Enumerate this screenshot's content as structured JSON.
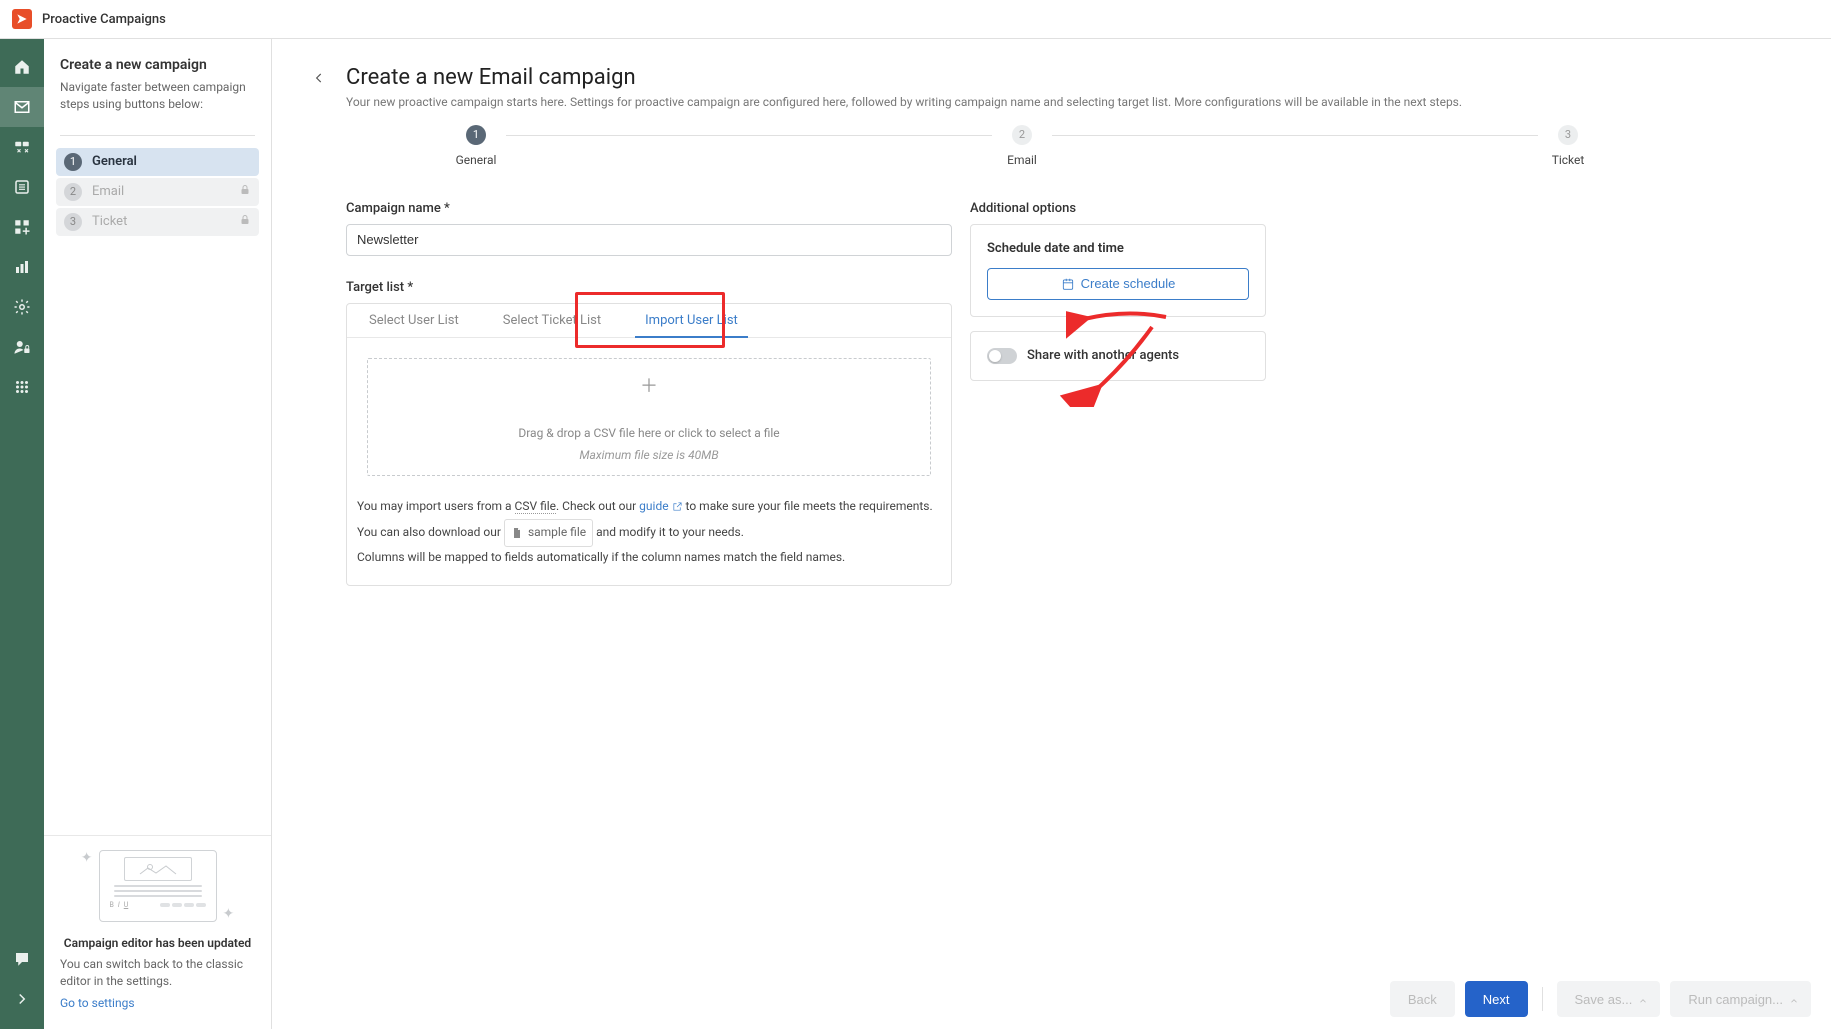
{
  "header": {
    "app_title": "Proactive Campaigns"
  },
  "sidebar": {
    "title": "Create a new campaign",
    "subtitle": "Navigate faster between campaign steps using buttons below:",
    "steps": [
      {
        "num": "1",
        "label": "General"
      },
      {
        "num": "2",
        "label": "Email"
      },
      {
        "num": "3",
        "label": "Ticket"
      }
    ],
    "updated_title": "Campaign editor has been updated",
    "updated_text": "You can switch back to the classic editor in the settings.",
    "updated_link": "Go to settings"
  },
  "page": {
    "title": "Create a new Email campaign",
    "subtitle": "Your new proactive campaign starts here. Settings for proactive campaign are configured here, followed by writing campaign name and selecting target list. More configurations will be available in the next steps."
  },
  "stepper": {
    "items": [
      {
        "num": "1",
        "label": "General"
      },
      {
        "num": "2",
        "label": "Email"
      },
      {
        "num": "3",
        "label": "Ticket"
      }
    ]
  },
  "form": {
    "campaign_name_label": "Campaign name *",
    "campaign_name_value": "Newsletter",
    "target_list_label": "Target list *",
    "tabs": {
      "select_user": "Select User List",
      "select_ticket": "Select Ticket List",
      "import_user": "Import User List"
    },
    "dropzone": {
      "text": "Drag & drop a CSV file here or click to select a file",
      "hint": "Maximum file size is 40MB"
    },
    "help": {
      "line1_prefix": "You may import users from a ",
      "csv_file": "CSV file",
      "check_out": ". Check out our ",
      "guide": "guide",
      "line1_suffix": " to make sure your file meets the requirements.",
      "line2_prefix": "You can also download our ",
      "sample_file": "sample file",
      "line2_suffix": " and modify it to your needs.",
      "line3": "Columns will be mapped to fields automatically if the column names match the field names."
    }
  },
  "options": {
    "title": "Additional options",
    "schedule_title": "Schedule date and time",
    "schedule_button": "Create schedule",
    "share_label": "Share with another agents"
  },
  "actions": {
    "back": "Back",
    "next": "Next",
    "save_as": "Save as...",
    "run_campaign": "Run campaign..."
  }
}
